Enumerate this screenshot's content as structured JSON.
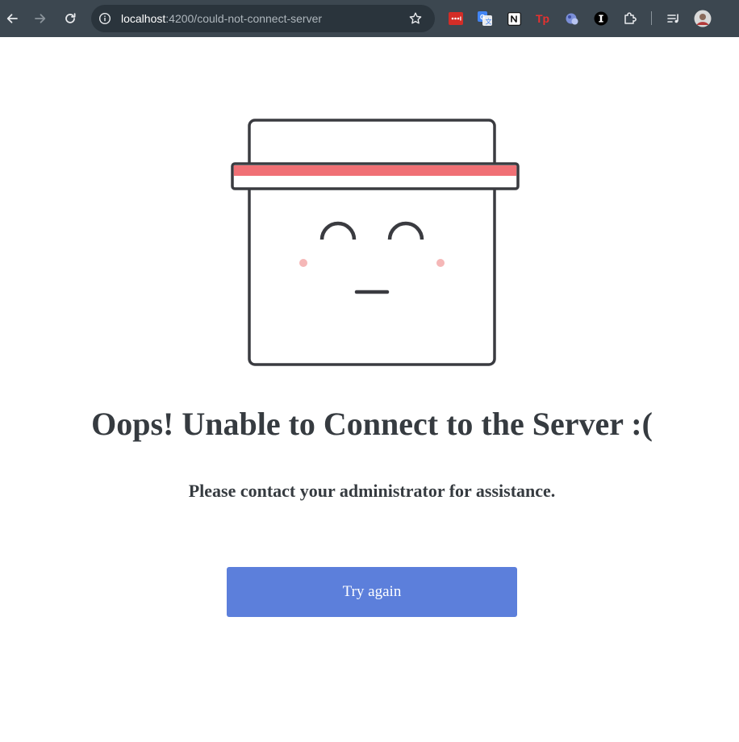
{
  "browser": {
    "url_host": "localhost",
    "url_path": ":4200/could-not-connect-server",
    "extensions": [
      {
        "name": "lastpass-icon",
        "color": "#d32d27"
      },
      {
        "name": "google-translate-icon",
        "color": "#4285f4"
      },
      {
        "name": "notion-icon",
        "color": "#ffffff"
      },
      {
        "name": "tp-icon",
        "color": "#e8312f",
        "label": "Tp"
      },
      {
        "name": "globe-extension-icon",
        "color": "#8ab4f8"
      },
      {
        "name": "info-i-icon",
        "color": "#000000",
        "label": "I"
      },
      {
        "name": "extensions-puzzle-icon",
        "color": "#e3e3e3"
      },
      {
        "name": "reading-list-icon",
        "color": "#e3e3e3"
      },
      {
        "name": "profile-avatar",
        "color": "#c9c9c9"
      }
    ]
  },
  "colors": {
    "toolbar": "#3c4750",
    "accent_button": "#5c7fdb",
    "mascot_stroke": "#3a3b40",
    "headband": "#f07075",
    "blush": "#f5b7b7",
    "text": "#363b40"
  },
  "page": {
    "title": "Oops! Unable to Connect to the Server :(",
    "message": "Please contact your administrator for assistance.",
    "retry_label": "Try again"
  }
}
